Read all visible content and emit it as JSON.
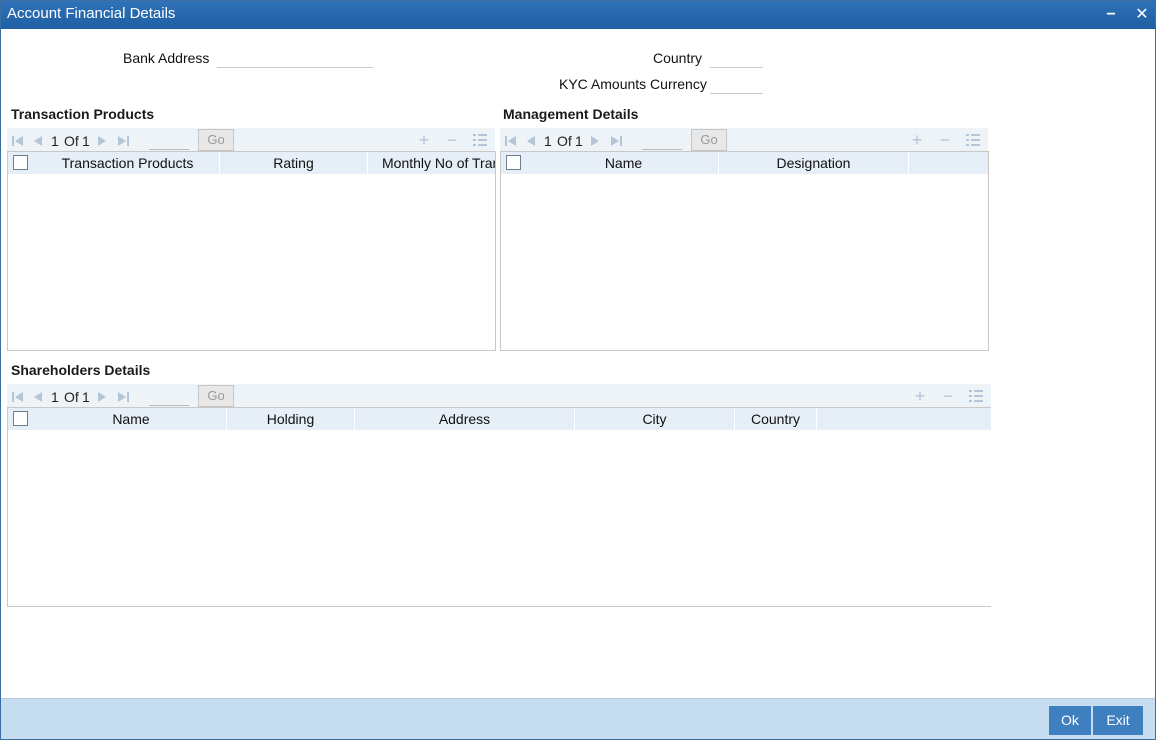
{
  "window": {
    "title": "Account Financial Details",
    "minimize_glyph": "−",
    "close_glyph": "✕"
  },
  "form": {
    "bank_address_label": "Bank Address",
    "bank_address_value": "",
    "country_label": "Country",
    "country_value": "",
    "kyc_currency_label": "KYC Amounts Currency",
    "kyc_currency_value": ""
  },
  "transaction_products": {
    "title": "Transaction Products",
    "pager": {
      "current": "1",
      "of_label": "Of",
      "total": "1",
      "go_label": "Go"
    },
    "columns": [
      "Transaction Products",
      "Rating",
      "Monthly No of Trans"
    ]
  },
  "management_details": {
    "title": "Management Details",
    "pager": {
      "current": "1",
      "of_label": "Of",
      "total": "1",
      "go_label": "Go"
    },
    "columns": [
      "Name",
      "Designation"
    ]
  },
  "shareholders_details": {
    "title": "Shareholders Details",
    "pager": {
      "current": "1",
      "of_label": "Of",
      "total": "1",
      "go_label": "Go"
    },
    "columns": [
      "Name",
      "Holding",
      "Address",
      "City",
      "Country"
    ]
  },
  "footer": {
    "ok_label": "Ok",
    "exit_label": "Exit"
  },
  "colors": {
    "title_bar": "#1f5fa3",
    "grid_header": "#e6eef7",
    "footer": "#c6dcf0",
    "button": "#3e7fc0"
  }
}
